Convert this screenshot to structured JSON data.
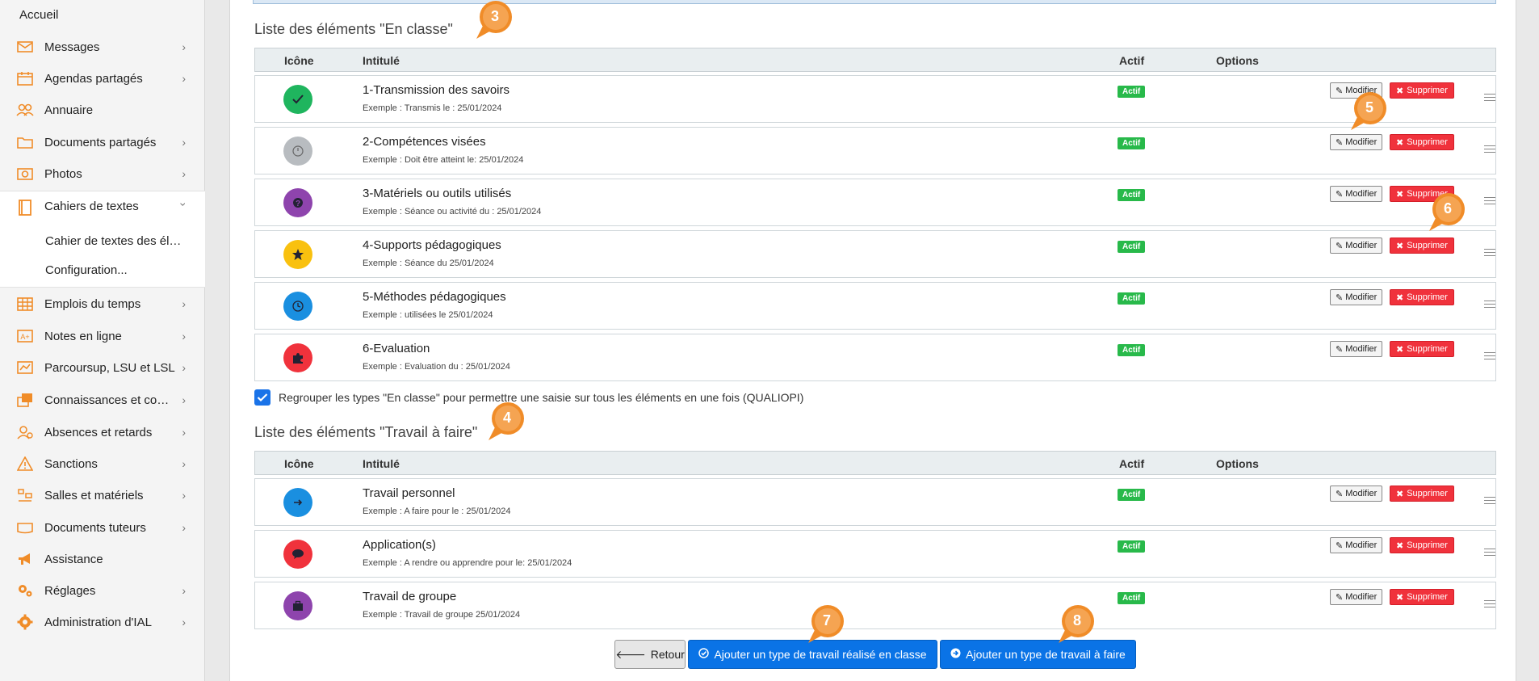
{
  "sidebar": {
    "home": "Accueil",
    "items": [
      {
        "label": "Messages",
        "icon": "mail-icon"
      },
      {
        "label": "Agendas partagés",
        "icon": "calendar-icon"
      },
      {
        "label": "Annuaire",
        "icon": "contacts-icon"
      },
      {
        "label": "Documents partagés",
        "icon": "folder-icon"
      },
      {
        "label": "Photos",
        "icon": "photo-icon"
      },
      {
        "label": "Cahiers de textes",
        "icon": "book-icon"
      },
      {
        "label": "Emplois du temps",
        "icon": "timetable-icon"
      },
      {
        "label": "Notes en ligne",
        "icon": "grades-icon"
      },
      {
        "label": "Parcoursup, LSU et LSL",
        "icon": "pathway-icon"
      },
      {
        "label": "Connaissances et comp…",
        "icon": "skills-icon"
      },
      {
        "label": "Absences et retards",
        "icon": "absences-icon"
      },
      {
        "label": "Sanctions",
        "icon": "warning-icon"
      },
      {
        "label": "Salles et matériels",
        "icon": "rooms-icon"
      },
      {
        "label": "Documents tuteurs",
        "icon": "tutor-docs-icon"
      },
      {
        "label": "Assistance",
        "icon": "megaphone-icon"
      },
      {
        "label": "Réglages",
        "icon": "settings-icon"
      },
      {
        "label": "Administration d'IAL",
        "icon": "gear-icon"
      }
    ],
    "subitems": [
      "Cahier de textes des élè…",
      "Configuration..."
    ]
  },
  "colors": {
    "accent": "#F08C28",
    "active_badge": "#28B94A",
    "delete": "#F0323C",
    "primary": "#0A73E6"
  },
  "headers": {
    "icon": "Icône",
    "title": "Intitulé",
    "active": "Actif",
    "options": "Options"
  },
  "buttons": {
    "modify": "Modifier",
    "delete": "Supprimer",
    "back": "Retour",
    "add_class": "Ajouter un type de travail réalisé en classe",
    "add_homework": "Ajouter un type de travail à faire"
  },
  "section_class": {
    "title": "Liste des éléments \"En classe\"",
    "rows": [
      {
        "title": "1-Transmission des savoirs",
        "example": "Exemple : Transmis le : 25/01/2024",
        "status": "Actif",
        "color": "#1FB55E",
        "icon": "check-icon"
      },
      {
        "title": "2-Compétences visées",
        "example": "Exemple : Doit être atteint le: 25/01/2024",
        "status": "Actif",
        "color": "#B8BCC0",
        "icon": "target-icon"
      },
      {
        "title": "3-Matériels ou outils utilisés",
        "example": "Exemple : Séance ou activité du : 25/01/2024",
        "status": "Actif",
        "color": "#8E44AD",
        "icon": "question-icon"
      },
      {
        "title": "4-Supports pédagogiques",
        "example": "Exemple : Séance du 25/01/2024",
        "status": "Actif",
        "color": "#F9C10F",
        "icon": "star-icon"
      },
      {
        "title": "5-Méthodes pédagogiques",
        "example": "Exemple : utilisées le 25/01/2024",
        "status": "Actif",
        "color": "#1A8FE0",
        "icon": "clock-icon"
      },
      {
        "title": "6-Evaluation",
        "example": "Exemple : Evaluation du : 25/01/2024",
        "status": "Actif",
        "color": "#F0323C",
        "icon": "puzzle-icon"
      }
    ]
  },
  "group_checkbox_label": "Regrouper les types \"En classe\" pour permettre une saisie sur tous les éléments en une fois (QUALIOPI)",
  "section_homework": {
    "title": "Liste des éléments \"Travail à faire\"",
    "rows": [
      {
        "title": "Travail personnel",
        "example": "Exemple : A faire pour le : 25/01/2024",
        "status": "Actif",
        "color": "#1A8FE0",
        "icon": "arrow-icon"
      },
      {
        "title": "Application(s)",
        "example": "Exemple : A rendre ou apprendre pour le: 25/01/2024",
        "status": "Actif",
        "color": "#F0323C",
        "icon": "comment-icon"
      },
      {
        "title": "Travail de groupe",
        "example": "Exemple : Travail de groupe 25/01/2024",
        "status": "Actif",
        "color": "#8E44AD",
        "icon": "briefcase-icon"
      }
    ]
  },
  "callouts": [
    "3",
    "4",
    "5",
    "6",
    "7",
    "8"
  ]
}
